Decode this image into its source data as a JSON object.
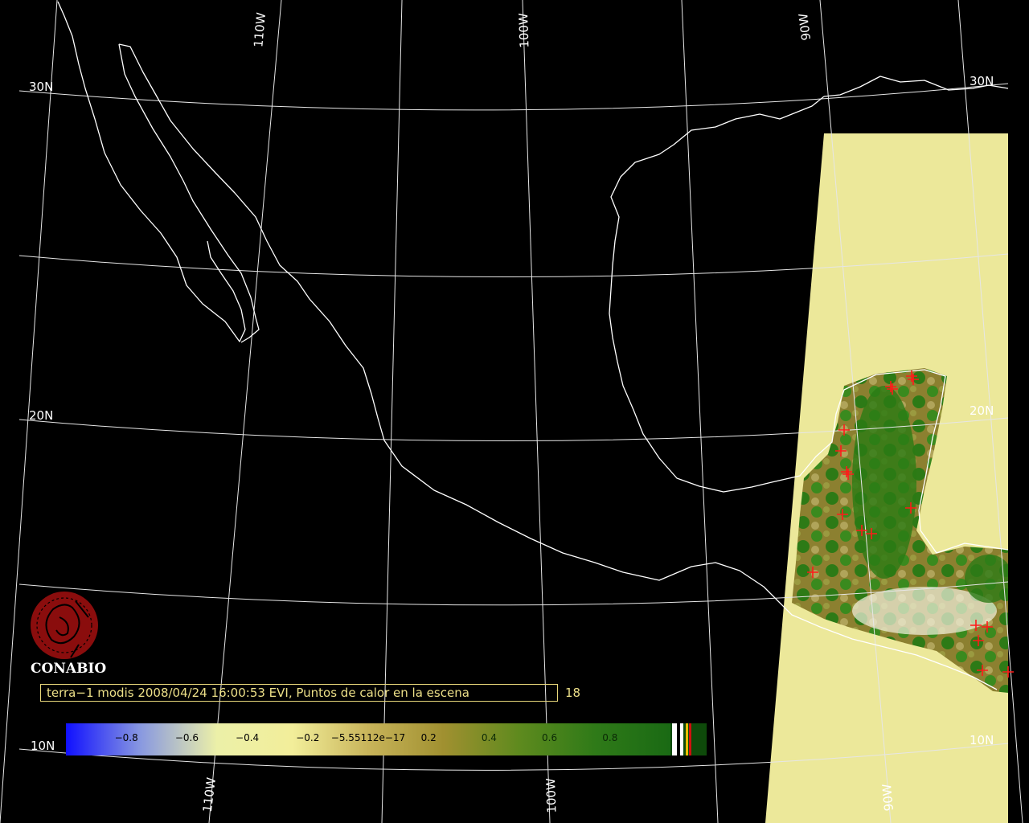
{
  "map": {
    "meridian_labels": [
      "110W",
      "100W",
      "90W"
    ],
    "parallel_labels": [
      "30N",
      "20N",
      "10N"
    ],
    "colors": {
      "background": "#000000",
      "coastline": "#ffffff",
      "graticule": "#e6e6e6",
      "swath_fill": "#ece89a",
      "vegetation_low": "#8c8030",
      "vegetation_high": "#1e7a12",
      "hotspot": "#ff1a1a"
    },
    "hotspot_count": 18
  },
  "logo": {
    "name": "CONABIO",
    "icon": "conabio-seal-icon",
    "color": "#8a0d0d"
  },
  "caption": {
    "text": "terra−1 modis 2008/04/24 16:00:53 EVI, Puntos de calor en la escena",
    "count": "18"
  },
  "colorbar": {
    "labels": [
      "−0.8",
      "−0.6",
      "−0.4",
      "−0.2",
      "−5.55112e−17",
      "0.2",
      "0.4",
      "0.6",
      "0.8"
    ],
    "label_values": [
      -0.8,
      -0.6,
      -0.4,
      -0.2,
      0,
      0.2,
      0.4,
      0.6,
      0.8
    ],
    "range": [
      -1,
      1
    ],
    "stops": [
      "#1010ff",
      "#8a9ae0",
      "#ecf0a8",
      "#f2ee9a",
      "#c8b45a",
      "#a09030",
      "#5e8a1e",
      "#2f7a18",
      "#1a6a14"
    ]
  }
}
